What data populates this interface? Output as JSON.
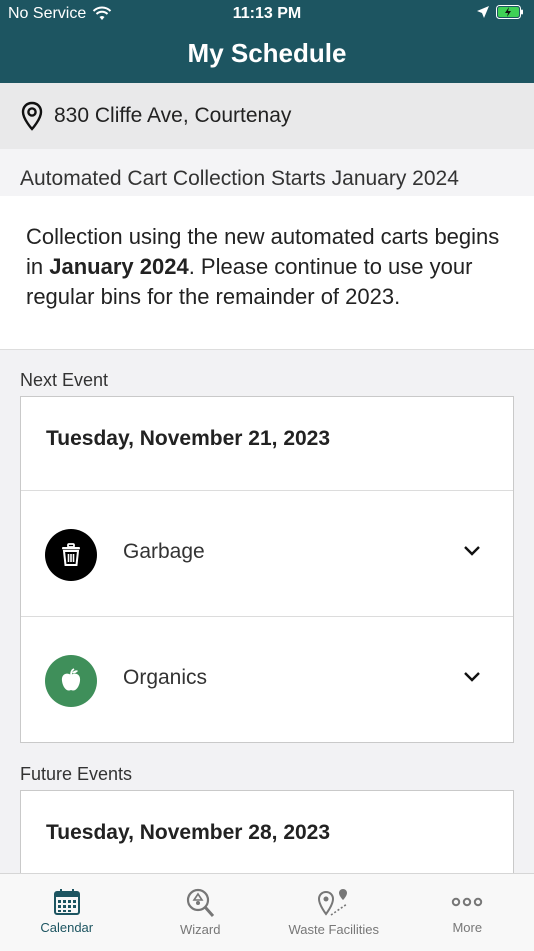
{
  "status_bar": {
    "carrier": "No Service",
    "time": "11:13 PM"
  },
  "header": {
    "title": "My Schedule"
  },
  "address": {
    "text": "830 Cliffe Ave, Courtenay"
  },
  "notice": {
    "title": "Automated Cart Collection Starts January 2024",
    "body_before": "Collection using the new automated carts begins in ",
    "body_bold": "January 2024",
    "body_after": ". Please continue to use your regular bins for the remainder of 2023."
  },
  "next_event": {
    "section_label": "Next Event",
    "date": "Tuesday, November 21, 2023",
    "items": [
      {
        "label": "Garbage",
        "icon": "trash-icon",
        "color": "#000000"
      },
      {
        "label": "Organics",
        "icon": "apple-icon",
        "color": "#3f8f5a"
      }
    ]
  },
  "future_events": {
    "section_label": "Future Events",
    "date": "Tuesday, November 28, 2023"
  },
  "tabbar": {
    "tabs": [
      {
        "label": "Calendar",
        "icon": "calendar-icon",
        "active": true
      },
      {
        "label": "Wizard",
        "icon": "wizard-search-icon",
        "active": false
      },
      {
        "label": "Waste Facilities",
        "icon": "map-pin-icon",
        "active": false
      },
      {
        "label": "More",
        "icon": "more-dots-icon",
        "active": false
      }
    ]
  }
}
